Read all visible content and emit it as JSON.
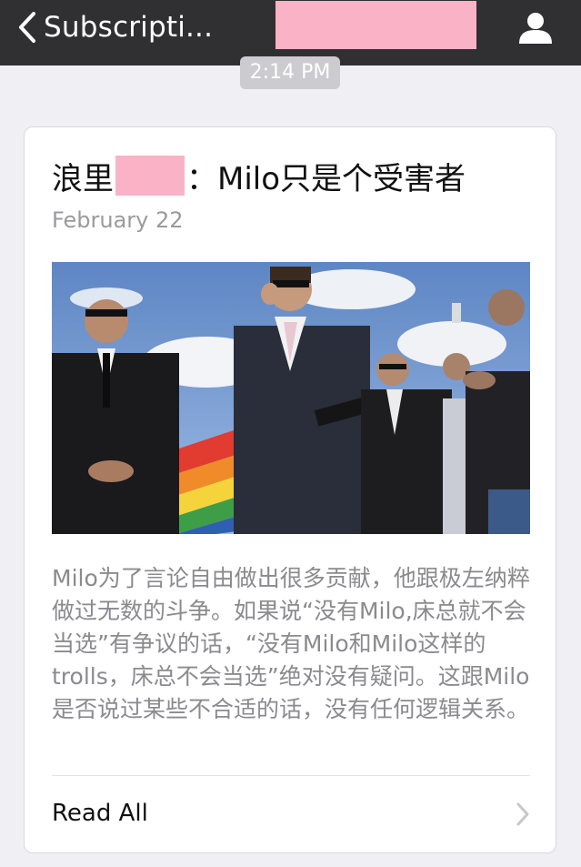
{
  "navbar": {
    "back_label": "Subscripti...",
    "back_icon": "chevron-left-icon",
    "profile_icon": "person-icon"
  },
  "timestamp": "2:14 PM",
  "article": {
    "title_prefix": "浪里",
    "title_suffix": "：Milo只是个受害者",
    "date": "February 22",
    "digest": "Milo为了言论自由做出很多贡献，他跟极左纳粹做过无数的斗争。如果说“没有Milo,床总就不会当选”有争议的话，“没有Milo和Milo这样的trolls，床总不会当选”绝对没有疑问。这跟Milo是否说过某些不合适的话，没有任何逻辑关系。",
    "read_all_label": "Read All"
  },
  "colors": {
    "navbar_bg": "#303033",
    "page_bg": "#efeff4",
    "redaction": "#f9b2c6",
    "digest_text": "#8a8a8f",
    "date_text": "#9a9a9f"
  }
}
